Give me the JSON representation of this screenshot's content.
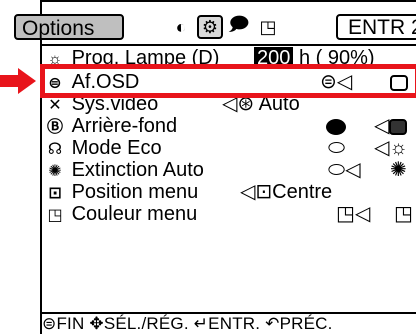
{
  "header": {
    "options_tab": "Options",
    "tab_icons": [
      "picture-icon",
      "settings-icon",
      "speech-icon",
      "display-icon"
    ],
    "entr_label": "ENTR 2"
  },
  "rows": [
    {
      "icon": "lamp-timer-icon",
      "label": "Prog. Lampe (D)",
      "value_box": "200",
      "value_rest": "h ( 90%)"
    },
    {
      "icon": "osd-icon",
      "label": "Af.OSD"
    },
    {
      "icon": "video-system-icon",
      "label": "Sys.video",
      "value": "Auto"
    },
    {
      "icon": "background-icon",
      "label": "Arrière-fond"
    },
    {
      "icon": "eco-mode-icon",
      "label": "Mode Eco"
    },
    {
      "icon": "auto-off-icon",
      "label": "Extinction Auto"
    },
    {
      "icon": "menu-position-icon",
      "label": "Position menu",
      "value": "Centre"
    },
    {
      "icon": "menu-color-icon",
      "label": "Couleur menu"
    }
  ],
  "footer": {
    "fin": "FIN",
    "sel": "SÉL./RÉG.",
    "entr": "ENTR.",
    "prec": "PRÉC."
  },
  "colors": {
    "highlight": "#e8141b",
    "tab_bg": "#bfbfbf"
  }
}
